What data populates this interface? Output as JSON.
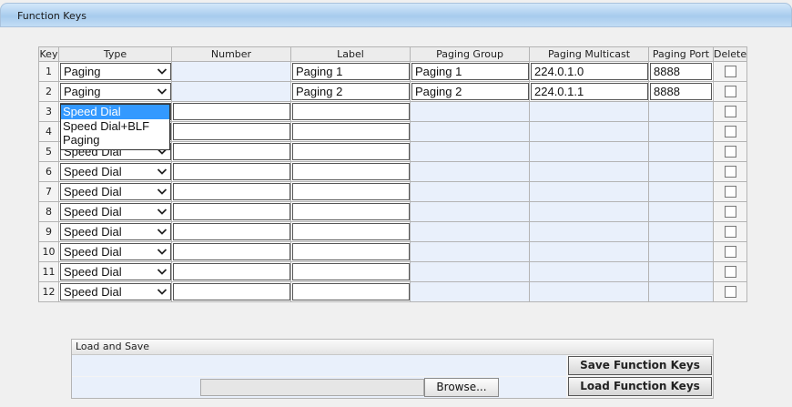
{
  "window": {
    "title": "Function Keys"
  },
  "table": {
    "headers": {
      "key": "Key",
      "type": "Type",
      "number": "Number",
      "label": "Label",
      "paging_group": "Paging Group",
      "paging_multicast": "Paging Multicast",
      "paging_port": "Paging Port",
      "delete": "Delete"
    },
    "rows": [
      {
        "key": "1",
        "type": "Paging",
        "number": "",
        "label": "Paging 1",
        "group": "Paging 1",
        "multicast": "224.0.1.0",
        "port": "8888"
      },
      {
        "key": "2",
        "type": "Paging",
        "number": "",
        "label": "Paging 2",
        "group": "Paging 2",
        "multicast": "224.0.1.1",
        "port": "8888"
      },
      {
        "key": "3",
        "type": "Speed Dial",
        "number": "",
        "label": ""
      },
      {
        "key": "4",
        "type": "Speed Dial",
        "number": "",
        "label": ""
      },
      {
        "key": "5",
        "type": "Speed Dial",
        "number": "",
        "label": ""
      },
      {
        "key": "6",
        "type": "Speed Dial",
        "number": "",
        "label": ""
      },
      {
        "key": "7",
        "type": "Speed Dial",
        "number": "",
        "label": ""
      },
      {
        "key": "8",
        "type": "Speed Dial",
        "number": "",
        "label": ""
      },
      {
        "key": "9",
        "type": "Speed Dial",
        "number": "",
        "label": ""
      },
      {
        "key": "10",
        "type": "Speed Dial",
        "number": "",
        "label": ""
      },
      {
        "key": "11",
        "type": "Speed Dial",
        "number": "",
        "label": ""
      },
      {
        "key": "12",
        "type": "Speed Dial",
        "number": "",
        "label": ""
      }
    ]
  },
  "type_dropdown": {
    "open_on_key": "3",
    "options": [
      "Speed Dial",
      "Speed Dial+BLF",
      "Paging"
    ],
    "highlighted": "Speed Dial",
    "highlight_color": "#3399ff"
  },
  "load_and_save": {
    "title": "Load and Save",
    "save_button": "Save Function Keys",
    "load_button": "Load Function Keys",
    "browse_button": "Browse..."
  }
}
